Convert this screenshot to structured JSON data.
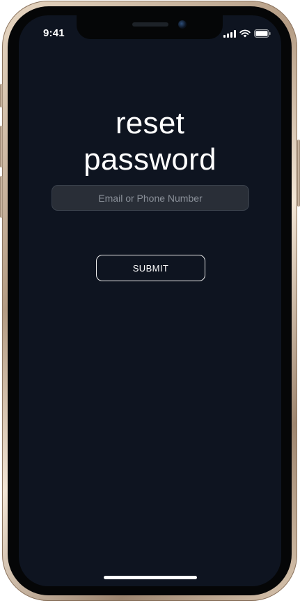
{
  "status_bar": {
    "time": "9:41",
    "icons": [
      "cellular-signal-icon",
      "wifi-icon",
      "battery-icon"
    ]
  },
  "reset": {
    "title_line1": "reset",
    "title_line2": "password",
    "input": {
      "value": "",
      "placeholder": "Email or Phone Number"
    },
    "submit_label": "SUBMIT"
  },
  "colors": {
    "screen_background": "#0e1420",
    "input_background": "#292e37",
    "text": "#ffffff"
  }
}
